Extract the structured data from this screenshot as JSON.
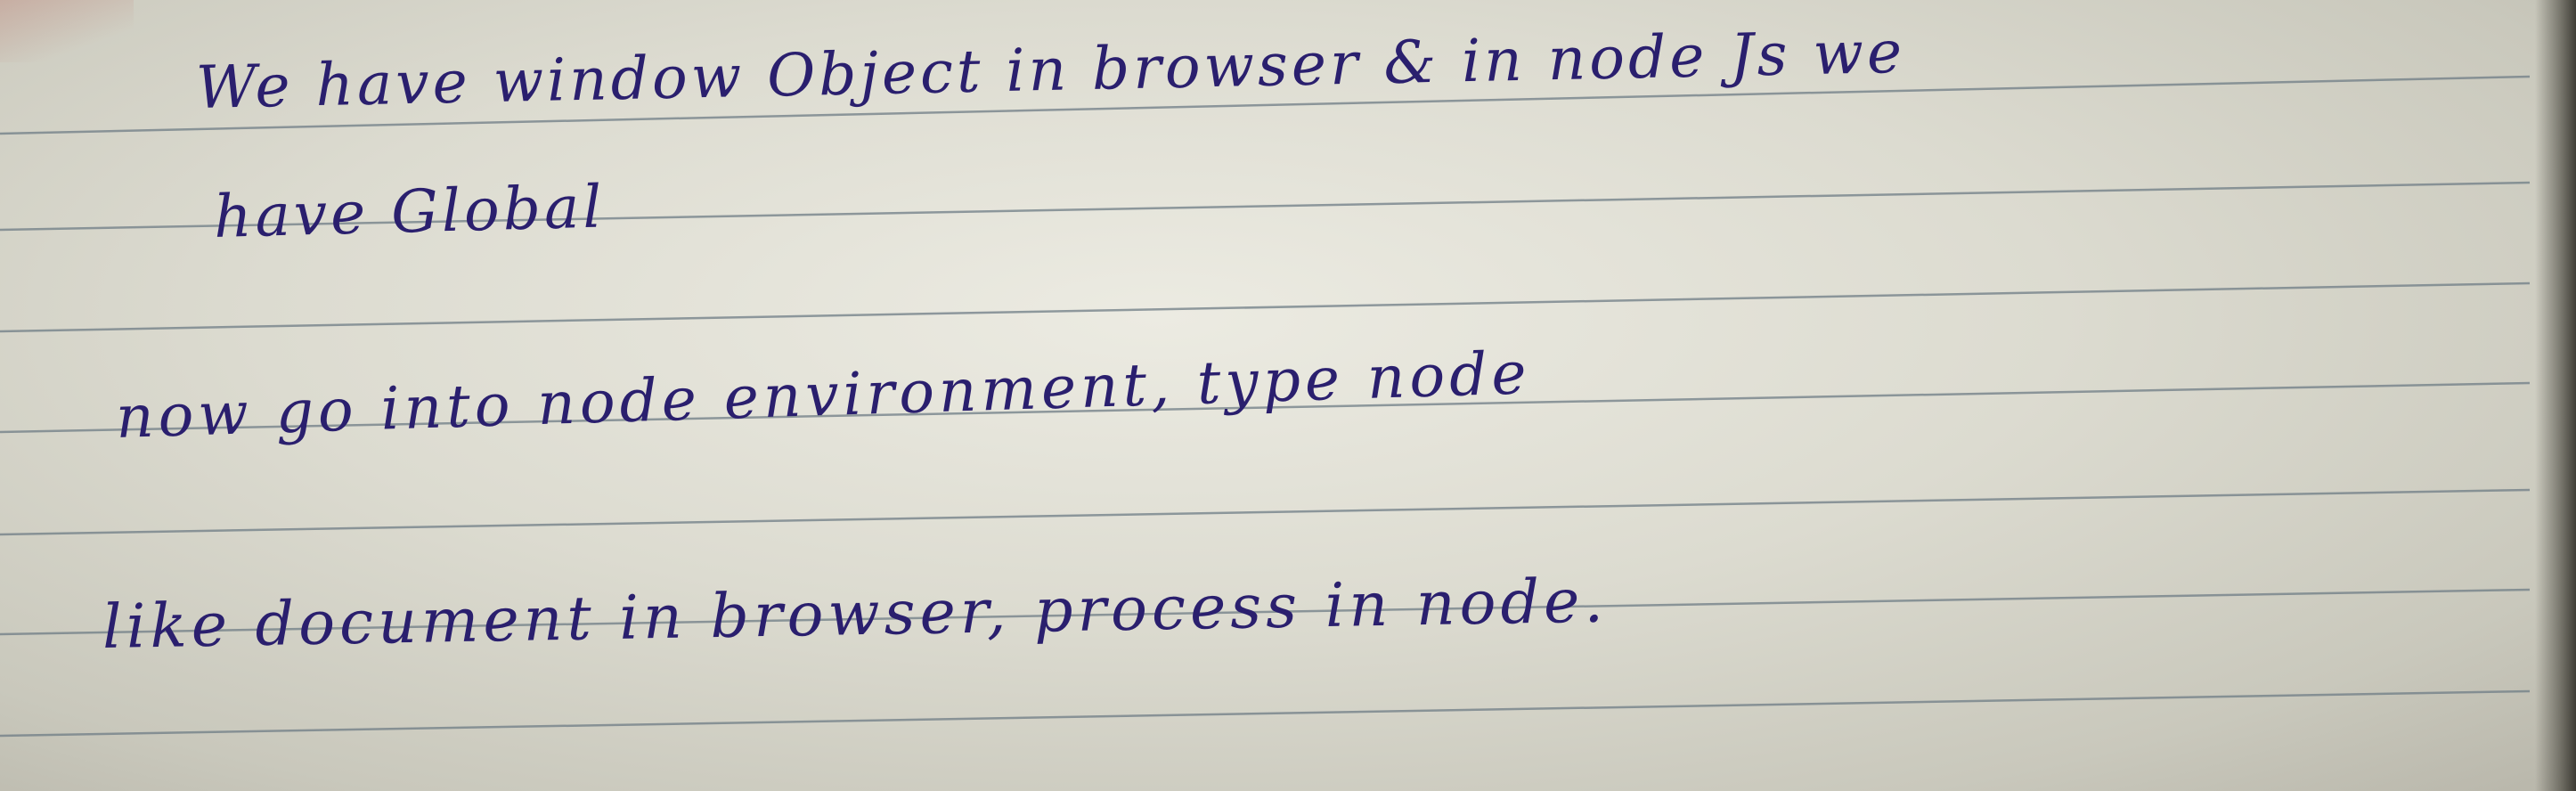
{
  "note": {
    "lines": [
      "We have window Object in browser & in node Js we",
      "have Global",
      "now go into node environment, type node",
      "like document in browser, process in node."
    ]
  },
  "colors": {
    "paper": "#e2e1d7",
    "ink": "#2a1f6e",
    "rule": "#6f7d86"
  }
}
